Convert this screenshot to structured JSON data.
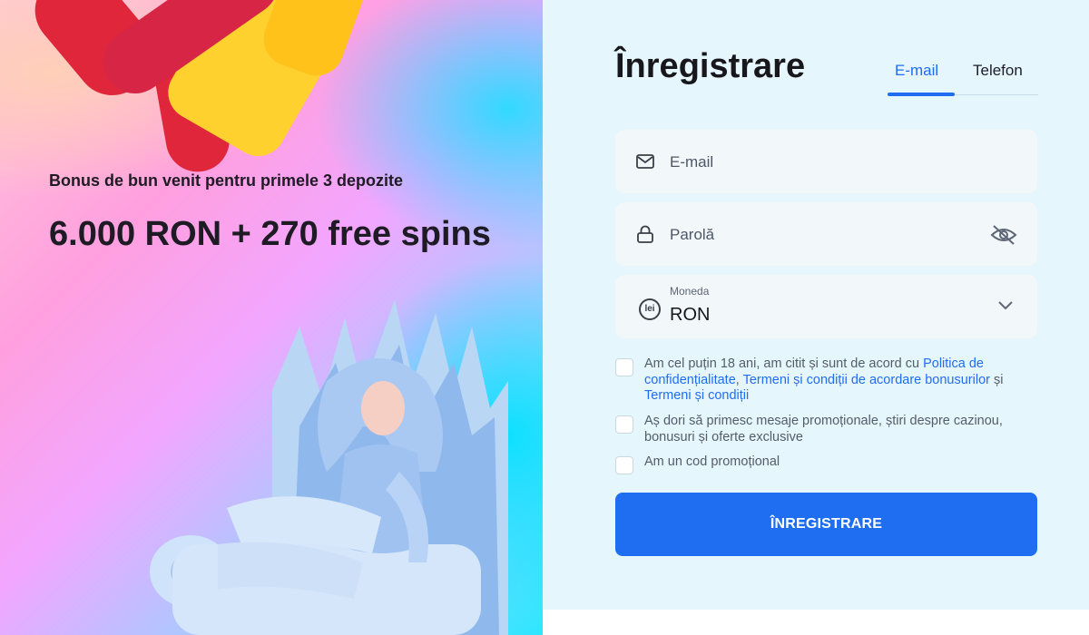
{
  "promo": {
    "subtitle": "Bonus de bun venit pentru primele 3 depozite",
    "headline": "6.000 RON + 270 free spins"
  },
  "form": {
    "title": "Înregistrare",
    "tabs": [
      {
        "label": "E-mail",
        "active": true
      },
      {
        "label": "Telefon",
        "active": false
      }
    ],
    "email_placeholder": "E-mail",
    "password_placeholder": "Parolă",
    "currency": {
      "label": "Moneda",
      "value": "RON",
      "icon_text": "lei"
    },
    "consents": [
      {
        "checked": false,
        "parts": [
          {
            "text": "Am cel puțin 18 ani, am citit și sunt de acord cu "
          },
          {
            "text": "Politica de confidențialitate",
            "link": true
          },
          {
            "text": ", "
          },
          {
            "text": "Termeni și condiții de acordare bonusurilor",
            "link": true
          },
          {
            "text": " și "
          },
          {
            "text": "Termeni și condiții",
            "link": true
          }
        ]
      },
      {
        "checked": false,
        "parts": [
          {
            "text": "Aș dori să primesc mesaje promoționale, știri despre cazinou, bonusuri și oferte exclusive"
          }
        ]
      },
      {
        "checked": false,
        "parts": [
          {
            "text": "Am un cod promoțional"
          }
        ]
      }
    ],
    "submit_label": "ÎNREGISTRARE"
  },
  "icons": [
    "envelope-icon",
    "lock-icon",
    "eye-off-icon",
    "lei-currency-icon",
    "chevron-down-icon"
  ],
  "colors": {
    "accent": "#1f6ef2",
    "panel_bg": "#e6f6fd",
    "field_bg": "#f2f7fa",
    "text_dark": "#17171c"
  }
}
